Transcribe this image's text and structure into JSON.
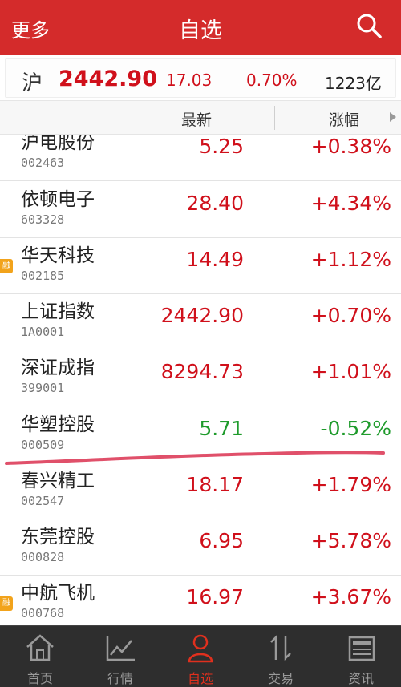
{
  "header": {
    "more_label": "更多",
    "title": "自选"
  },
  "index_bar": {
    "market": "沪",
    "price": "2442.90",
    "change": "17.03",
    "percent": "0.70%",
    "volume": "1223亿"
  },
  "columns": {
    "latest": "最新",
    "change": "涨幅"
  },
  "rows": [
    {
      "name": "沪电股份",
      "code": "002463",
      "price": "5.25",
      "pct": "+0.38%",
      "dir": "up",
      "flag": ""
    },
    {
      "name": "依顿电子",
      "code": "603328",
      "price": "28.40",
      "pct": "+4.34%",
      "dir": "up",
      "flag": ""
    },
    {
      "name": "华天科技",
      "code": "002185",
      "price": "14.49",
      "pct": "+1.12%",
      "dir": "up",
      "flag": "融"
    },
    {
      "name": "上证指数",
      "code": "1A0001",
      "price": "2442.90",
      "pct": "+0.70%",
      "dir": "up",
      "flag": ""
    },
    {
      "name": "深证成指",
      "code": "399001",
      "price": "8294.73",
      "pct": "+1.01%",
      "dir": "up",
      "flag": ""
    },
    {
      "name": "华塑控股",
      "code": "000509",
      "price": "5.71",
      "pct": "-0.52%",
      "dir": "down",
      "flag": ""
    },
    {
      "name": "春兴精工",
      "code": "002547",
      "price": "18.17",
      "pct": "+1.79%",
      "dir": "up",
      "flag": ""
    },
    {
      "name": "东莞控股",
      "code": "000828",
      "price": "6.95",
      "pct": "+5.78%",
      "dir": "up",
      "flag": ""
    },
    {
      "name": "中航飞机",
      "code": "000768",
      "price": "16.97",
      "pct": "+3.67%",
      "dir": "up",
      "flag": "融"
    }
  ],
  "tabs": [
    {
      "label": "首页",
      "icon": "home-icon",
      "active": false
    },
    {
      "label": "行情",
      "icon": "chart-icon",
      "active": false
    },
    {
      "label": "自选",
      "icon": "user-icon",
      "active": true
    },
    {
      "label": "交易",
      "icon": "trade-arrows-icon",
      "active": false
    },
    {
      "label": "资讯",
      "icon": "news-icon",
      "active": false
    }
  ],
  "colors": {
    "header_red": "#d42b2b",
    "up_red": "#d0101b",
    "down_green": "#1f9b2c",
    "tab_active": "#e0301e",
    "annotation_line": "#e0506a",
    "flag_orange": "#f2a31b"
  }
}
